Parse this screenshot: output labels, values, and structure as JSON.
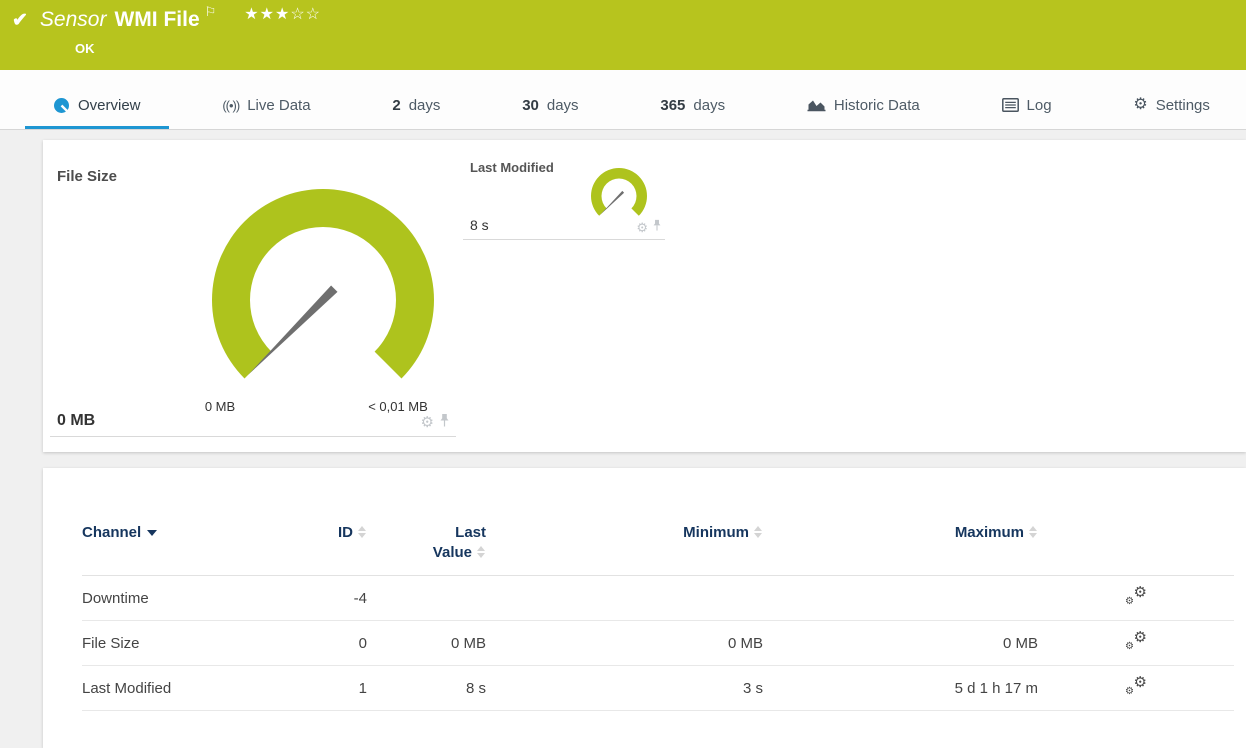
{
  "header": {
    "kind_label": "Sensor",
    "title": "WMI File",
    "status": "OK",
    "stars": "★★★☆☆",
    "stars_filled": 3,
    "stars_total": 5,
    "background_color": "#b7c41e"
  },
  "tabs": [
    {
      "label": "Overview",
      "icon": "gauge-icon",
      "active": true
    },
    {
      "label": "Live Data",
      "icon": "broadcast-icon",
      "glyph": "((•))"
    },
    {
      "num": "2",
      "label": "days"
    },
    {
      "num": "30",
      "label": "days"
    },
    {
      "num": "365",
      "label": "days"
    },
    {
      "label": "Historic Data",
      "icon": "area-chart-icon"
    },
    {
      "label": "Log",
      "icon": "log-icon"
    },
    {
      "label": "Settings",
      "icon": "gear-icon",
      "glyph": "⚙"
    }
  ],
  "accent_blue": "#1e96d2",
  "gauges": {
    "file_size": {
      "title": "File Size",
      "value": "0 MB",
      "scale_min": "0 MB",
      "scale_max": "< 0,01 MB",
      "color": "#aec31d",
      "needle_color": "#6f6f6f",
      "gear_glyph": "⚙"
    },
    "last_modified": {
      "title": "Last Modified",
      "value": "8 s",
      "color": "#aec31d",
      "needle_color": "#6f6f6f",
      "gear_glyph": "⚙"
    }
  },
  "channel_table": {
    "columns": {
      "channel": "Channel",
      "id": "ID",
      "last_value": "Last Value",
      "minimum": "Minimum",
      "maximum": "Maximum"
    },
    "sorted_by": "Channel",
    "rows": [
      {
        "channel": "Downtime",
        "id": "-4",
        "last_value": "",
        "minimum": "",
        "maximum": ""
      },
      {
        "channel": "File Size",
        "id": "0",
        "last_value": "0 MB",
        "minimum": "0 MB",
        "maximum": "0 MB"
      },
      {
        "channel": "Last Modified",
        "id": "1",
        "last_value": "8 s",
        "minimum": "3 s",
        "maximum": "5 d 1 h 17 m"
      }
    ],
    "gear_glyph": "⚙"
  }
}
